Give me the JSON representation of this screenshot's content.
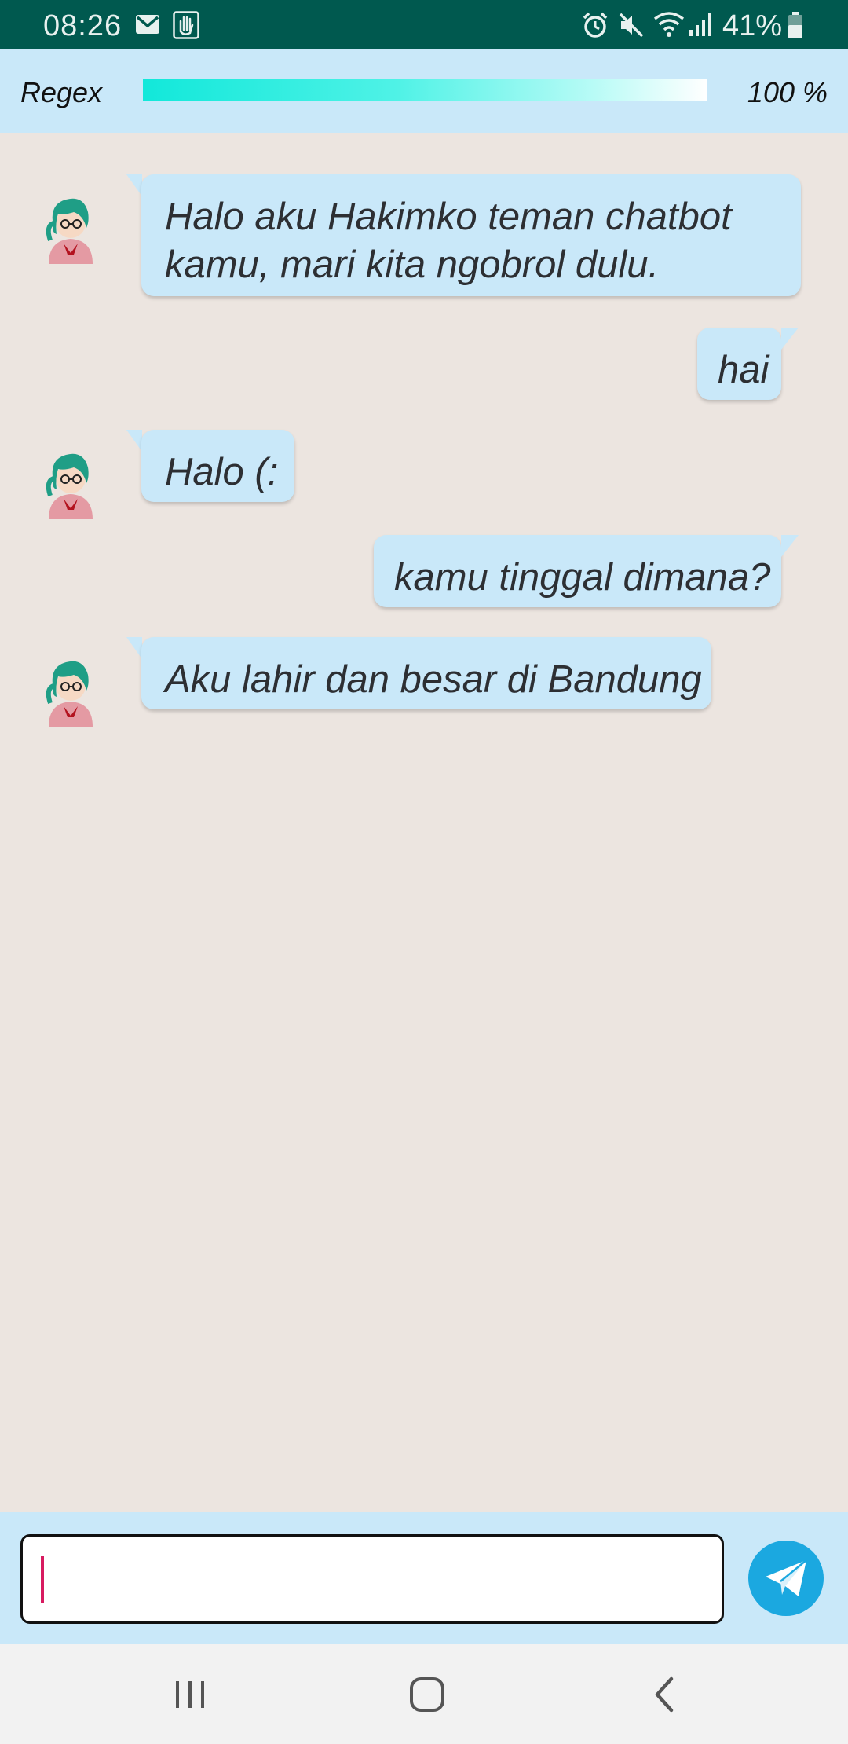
{
  "status_bar": {
    "time": "08:26",
    "battery_percent": "41%",
    "icons": [
      "gmail-icon",
      "hand-app-icon",
      "alarm-icon",
      "mute-icon",
      "wifi-icon",
      "signal-icon",
      "battery-icon"
    ]
  },
  "header": {
    "label": "Regex",
    "progress": 1.0,
    "percent_text": "100 %"
  },
  "messages": [
    {
      "from": "bot",
      "lines": [
        "Halo aku Hakimko teman chatbot",
        "kamu, mari kita ngobrol dulu."
      ]
    },
    {
      "from": "user",
      "lines": [
        "hai"
      ]
    },
    {
      "from": "bot",
      "lines": [
        "Halo (:"
      ]
    },
    {
      "from": "user",
      "lines": [
        "kamu tinggal dimana?"
      ]
    },
    {
      "from": "bot",
      "lines": [
        "Aku lahir dan besar di Bandung"
      ]
    }
  ],
  "input": {
    "value": "",
    "placeholder": ""
  },
  "colors": {
    "status_bar": "#00594f",
    "header_bg": "#c9e8f9",
    "bubble": "#c9e8f9",
    "chat_bg": "#ece5e0",
    "send_button": "#1ba8e0",
    "caret": "#d81b60"
  },
  "nav": {
    "icons": [
      "recents-icon",
      "home-icon",
      "back-icon"
    ]
  }
}
